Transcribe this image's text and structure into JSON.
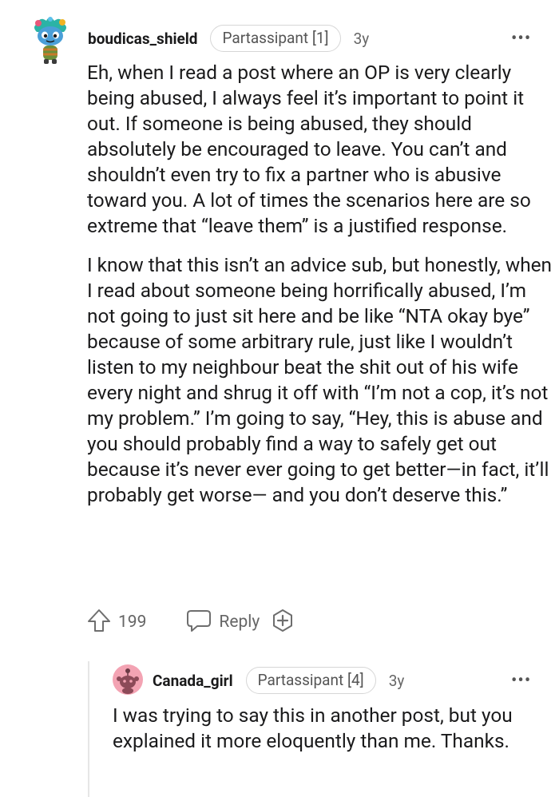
{
  "comment": {
    "author": "boudicas_shield",
    "flair": "Partassipant [1]",
    "age": "3y",
    "paragraphs": [
      "Eh, when I read a post where an OP is very clearly being abused, I always feel it’s important to point it out. If someone is being abused, they should absolutely be encouraged to leave. You can’t and shouldn’t even try to fix a partner who is abusive toward you. A lot of times the scenarios here are so extreme that “leave them” is a justified response.",
      "I know that this isn’t an advice sub, but honestly, when I read about someone being horrifically abused, I’m not going to just sit here and be like “NTA okay bye” because of some arbitrary rule, just like I wouldn’t listen to my neighbour beat the shit out of his wife every night and shrug it off with “I’m not a cop, it’s not my problem.” I’m going to say, “Hey, this is abuse and you should probably find a way to safely get out because it’s never ever going to get better—in fact, it’ll probably get worse— and you don’t deserve this.”"
    ],
    "upvotes": "199",
    "reply_label": "Reply",
    "more": "•••"
  },
  "reply": {
    "author": "Canada_girl",
    "flair": "Partassipant [4]",
    "age": "3y",
    "text": "I was trying to say this in another post, but you explained it more eloquently than me. Thanks.",
    "more": "•••"
  },
  "colors": {
    "text": "#1a1a1b",
    "meta": "#666666",
    "flair_border": "#d6d6d6",
    "avatar2_bg": "#f3a3b3"
  },
  "icons": [
    "snoo-avatar-icon",
    "more-options-icon",
    "upvote-icon",
    "reply-icon",
    "award-icon",
    "snoo-default-avatar-icon"
  ]
}
